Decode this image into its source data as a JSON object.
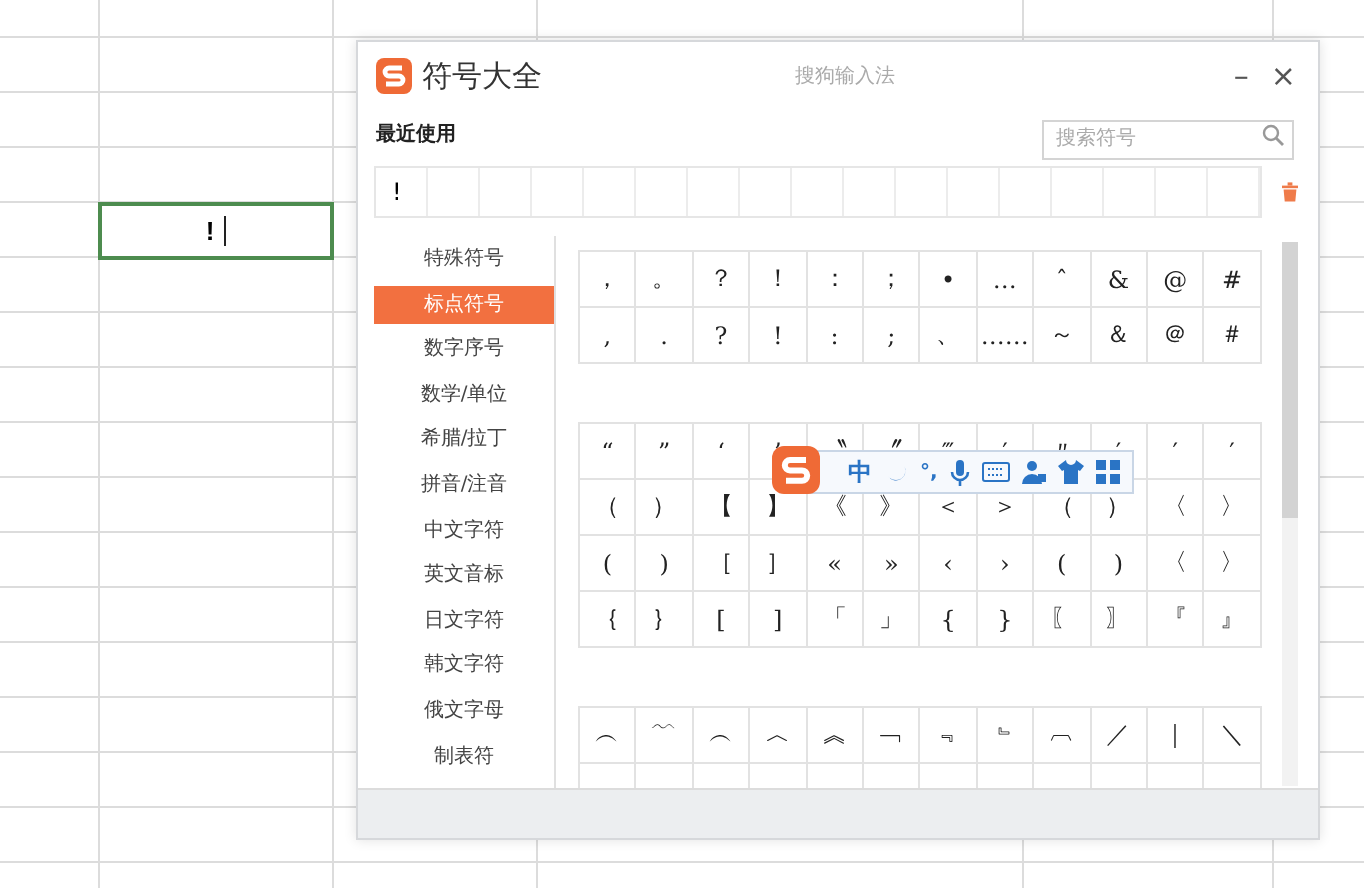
{
  "sheet": {
    "active_cell": {
      "value": "!"
    }
  },
  "window": {
    "title": "符号大全",
    "subtitle": "搜狗输入法",
    "minimize": "–",
    "close": "×"
  },
  "recent": {
    "label": "最近使用",
    "search": {
      "placeholder": "搜索符号"
    },
    "symbols": [
      "!"
    ]
  },
  "categories": [
    {
      "label": "特殊符号",
      "selected": false
    },
    {
      "label": "标点符号",
      "selected": true
    },
    {
      "label": "数字序号",
      "selected": false
    },
    {
      "label": "数学/单位",
      "selected": false
    },
    {
      "label": "希腊/拉丁",
      "selected": false
    },
    {
      "label": "拼音/注音",
      "selected": false
    },
    {
      "label": "中文字符",
      "selected": false
    },
    {
      "label": "英文音标",
      "selected": false
    },
    {
      "label": "日文字符",
      "selected": false
    },
    {
      "label": "韩文字符",
      "selected": false
    },
    {
      "label": "俄文字母",
      "selected": false
    },
    {
      "label": "制表符",
      "selected": false
    }
  ],
  "groups": [
    {
      "rows": [
        [
          "，",
          "。",
          "？",
          "！",
          "：",
          "；",
          "•",
          "…",
          "ˆ",
          "&",
          "@",
          "#"
        ],
        [
          ",",
          ".",
          "?",
          "!",
          ":",
          ";",
          "、",
          "……",
          "～",
          "＆",
          "＠",
          "＃"
        ]
      ]
    },
    {
      "rows": [
        [
          "“",
          "”",
          "‘",
          "’",
          "〝",
          "〞",
          "‴",
          "′",
          "〃",
          "′",
          "′",
          "′"
        ],
        [
          "（",
          "）",
          "【",
          "】",
          "《",
          "》",
          "＜",
          "＞",
          "（",
          "）",
          "〈",
          "〉"
        ],
        [
          "(",
          ")",
          "［",
          "］",
          "«",
          "»",
          "‹",
          "›",
          "(",
          ")",
          "〈",
          "〉"
        ],
        [
          "｛",
          "｝",
          "[",
          "]",
          "「",
          "」",
          "{",
          "}",
          "〖",
          "〗",
          "『",
          "』"
        ]
      ]
    },
    {
      "rows": [
        [
          "︵",
          "﹋",
          "︵",
          "︿",
          "︽",
          "﹁",
          "﹃",
          "﹄",
          "︹",
          "／",
          "｜",
          "＼"
        ]
      ]
    }
  ],
  "ime_toolbar": {
    "mode": "中",
    "punct": "°,"
  }
}
